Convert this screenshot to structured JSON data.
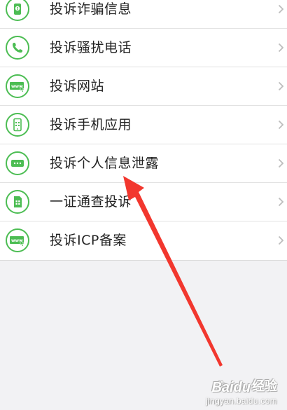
{
  "list": {
    "items": [
      {
        "label": "投诉诈骗信息",
        "icon": "phone-warning-icon"
      },
      {
        "label": "投诉骚扰电话",
        "icon": "phone-icon"
      },
      {
        "label": "投诉网站",
        "icon": "www-icon"
      },
      {
        "label": "投诉手机应用",
        "icon": "mobile-app-icon"
      },
      {
        "label": "投诉个人信息泄露",
        "icon": "message-dots-icon"
      },
      {
        "label": "一证通查投诉",
        "icon": "sim-card-icon"
      },
      {
        "label": "投诉ICP备案",
        "icon": "www-icon"
      }
    ]
  },
  "colors": {
    "icon_green": "#4cbd53",
    "arrow_red": "#f2372e",
    "background": "#f2f2f4"
  },
  "annotation": {
    "type": "red-arrow",
    "points_to": "投诉个人信息泄露"
  },
  "watermark": {
    "logo": "Baidu",
    "text": "经验",
    "url": "jingyan.baidu.com"
  }
}
